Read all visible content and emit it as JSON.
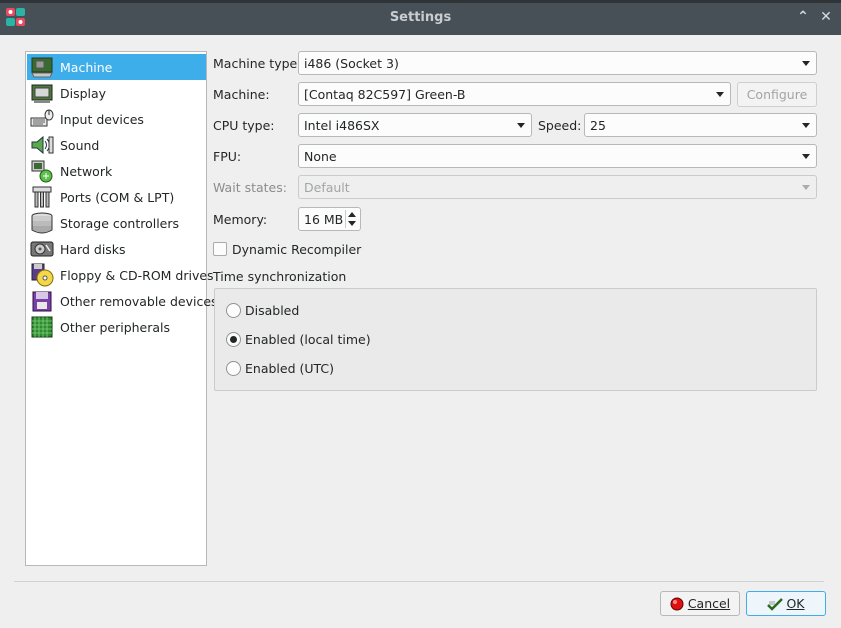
{
  "window": {
    "title": "Settings",
    "minimize_glyph": "⌃",
    "close_glyph": "✕"
  },
  "sidebar": {
    "items": [
      {
        "label": "Machine",
        "icon": "machine-icon",
        "selected": true
      },
      {
        "label": "Display",
        "icon": "display-icon"
      },
      {
        "label": "Input devices",
        "icon": "input-devices-icon"
      },
      {
        "label": "Sound",
        "icon": "sound-icon"
      },
      {
        "label": "Network",
        "icon": "network-icon"
      },
      {
        "label": "Ports (COM & LPT)",
        "icon": "ports-icon"
      },
      {
        "label": "Storage controllers",
        "icon": "storage-controllers-icon"
      },
      {
        "label": "Hard disks",
        "icon": "hard-disks-icon"
      },
      {
        "label": "Floppy & CD-ROM drives",
        "icon": "floppy-cdrom-icon"
      },
      {
        "label": "Other removable devices",
        "icon": "removable-devices-icon"
      },
      {
        "label": "Other peripherals",
        "icon": "peripherals-icon"
      }
    ]
  },
  "machine": {
    "machine_type_label": "Machine type:",
    "machine_type_value": "i486 (Socket 3)",
    "machine_label": "Machine:",
    "machine_value": "[Contaq 82C597] Green-B",
    "configure_label": "Configure",
    "cpu_type_label": "CPU type:",
    "cpu_type_value": "Intel i486SX",
    "speed_label": "Speed:",
    "speed_value": "25",
    "fpu_label": "FPU:",
    "fpu_value": "None",
    "wait_states_label": "Wait states:",
    "wait_states_value": "Default",
    "memory_label": "Memory:",
    "memory_value": "16 MB",
    "dynarec_label": "Dynamic Recompiler",
    "dynarec_checked": false,
    "time_sync_label": "Time synchronization",
    "time_sync_options": [
      {
        "label": "Disabled",
        "checked": false
      },
      {
        "label": "Enabled (local time)",
        "checked": true
      },
      {
        "label": "Enabled (UTC)",
        "checked": false
      }
    ]
  },
  "buttons": {
    "cancel_label": "Cancel",
    "ok_label": "OK"
  },
  "colors": {
    "accent": "#3daee9",
    "titlebar": "#475057",
    "window_bg": "#efefef"
  }
}
